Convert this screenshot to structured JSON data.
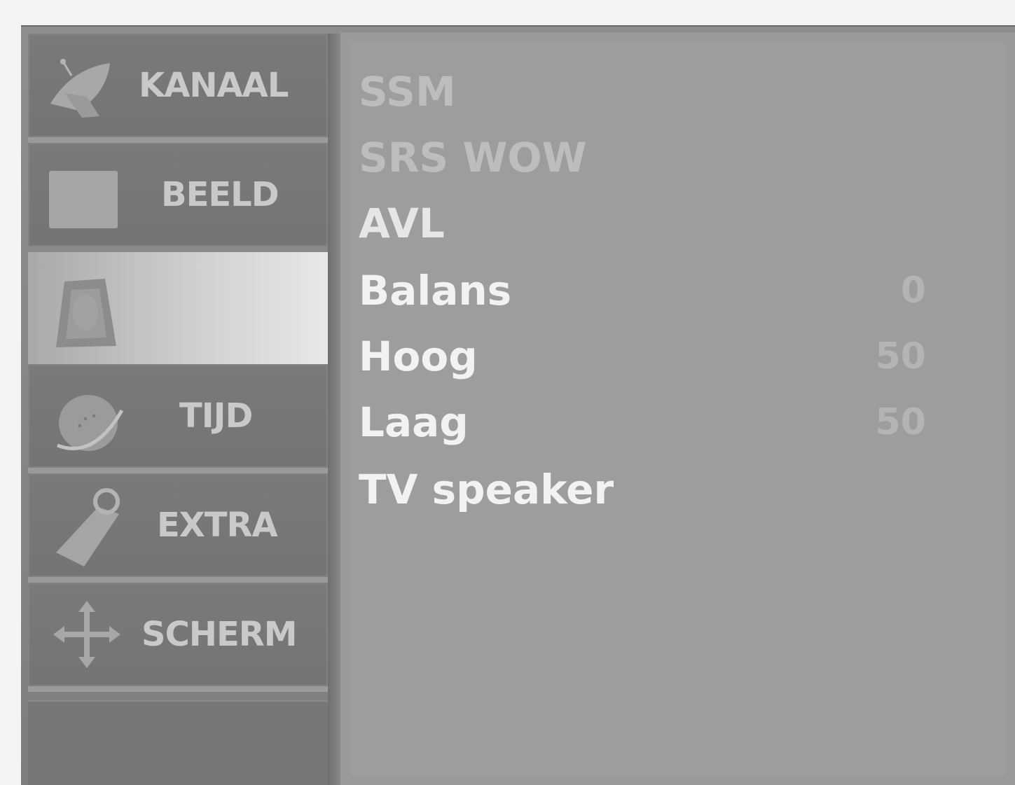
{
  "sidebar": {
    "items": [
      {
        "label": "KANAAL",
        "icon": "satellite-dish-icon"
      },
      {
        "label": "BEELD",
        "icon": "picture-square-icon"
      },
      {
        "label": "",
        "icon": "speaker-icon"
      },
      {
        "label": "TIJD",
        "icon": "clock-globe-icon"
      },
      {
        "label": "EXTRA",
        "icon": "tag-icon"
      },
      {
        "label": "SCHERM",
        "icon": "move-arrows-icon"
      }
    ]
  },
  "panel": {
    "rows": [
      {
        "label": "SSM",
        "value": ""
      },
      {
        "label": "SRS WOW",
        "value": ""
      },
      {
        "label": "AVL",
        "value": ""
      },
      {
        "label": "Balans",
        "value": "0"
      },
      {
        "label": "Hoog",
        "value": "50"
      },
      {
        "label": "Laag",
        "value": "50"
      },
      {
        "label": "TV speaker",
        "value": ""
      }
    ]
  }
}
